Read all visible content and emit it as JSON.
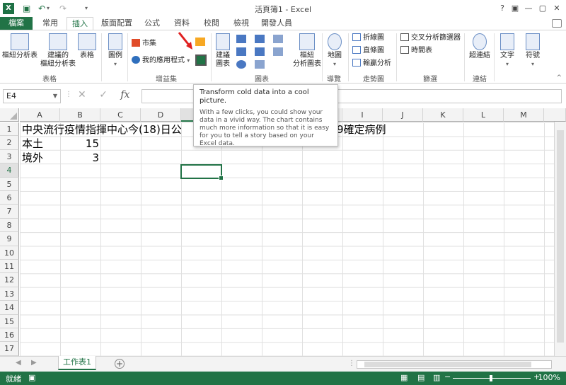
{
  "window": {
    "title": "活頁簿1 - Excel"
  },
  "tabs": {
    "file": "檔案",
    "items": [
      "常用",
      "插入",
      "版面配置",
      "公式",
      "資料",
      "校閱",
      "檢視",
      "開發人員"
    ],
    "active_index": 1
  },
  "ribbon": {
    "tables": {
      "pivot": "樞紐分析表",
      "recommended_pivot_1": "建議的",
      "recommended_pivot_2": "樞紐分析表",
      "table": "表格",
      "group": "表格"
    },
    "illustrations": {
      "label": "圖例"
    },
    "addins": {
      "store": "市集",
      "my_apps": "我的應用程式",
      "group": "增益集"
    },
    "charts": {
      "recommended_1": "建議",
      "recommended_2": "圖表",
      "pivot_chart_1": "樞紐",
      "pivot_chart_2": "分析圖表",
      "group": "圖表"
    },
    "tours": {
      "map": "地圖",
      "group": "導覽"
    },
    "sparklines": {
      "line": "折線圖",
      "column": "直條圖",
      "winloss": "輸贏分析",
      "group": "走勢圖"
    },
    "filters": {
      "slicer": "交叉分析篩選器",
      "timeline": "時間表",
      "group": "篩選"
    },
    "links": {
      "hyperlink": "超連結",
      "group": "連結"
    },
    "text": {
      "label": "文字"
    },
    "symbols": {
      "label": "符號"
    }
  },
  "formula_bar": {
    "name_box": "E4",
    "fx": "fx",
    "value": ""
  },
  "grid": {
    "columns": [
      "A",
      "B",
      "C",
      "D",
      "E",
      "F",
      "G",
      "H",
      "I",
      "J",
      "K",
      "L",
      "M"
    ],
    "rows": [
      "1",
      "2",
      "3",
      "4",
      "5",
      "6",
      "7",
      "8",
      "9",
      "10",
      "11",
      "12",
      "13",
      "14",
      "15",
      "16",
      "17"
    ],
    "a1": "中央流行疫情指揮中心今(18)日公",
    "a1_tail": "9確定病例",
    "a2": "本土",
    "b2": "15",
    "a3": "境外",
    "b3": "3"
  },
  "tooltip": {
    "title": "Transform cold data into a cool picture.",
    "body": "With a few clicks, you could show your data in a vivid way. The chart contains much more information so that it is easy for you to tell a story based on your Excel data."
  },
  "sheets": {
    "active": "工作表1",
    "add": "+"
  },
  "status": {
    "ready": "就緒",
    "zoom": "100%"
  },
  "colors": {
    "accent": "#217346",
    "arrow": "#e02020"
  }
}
